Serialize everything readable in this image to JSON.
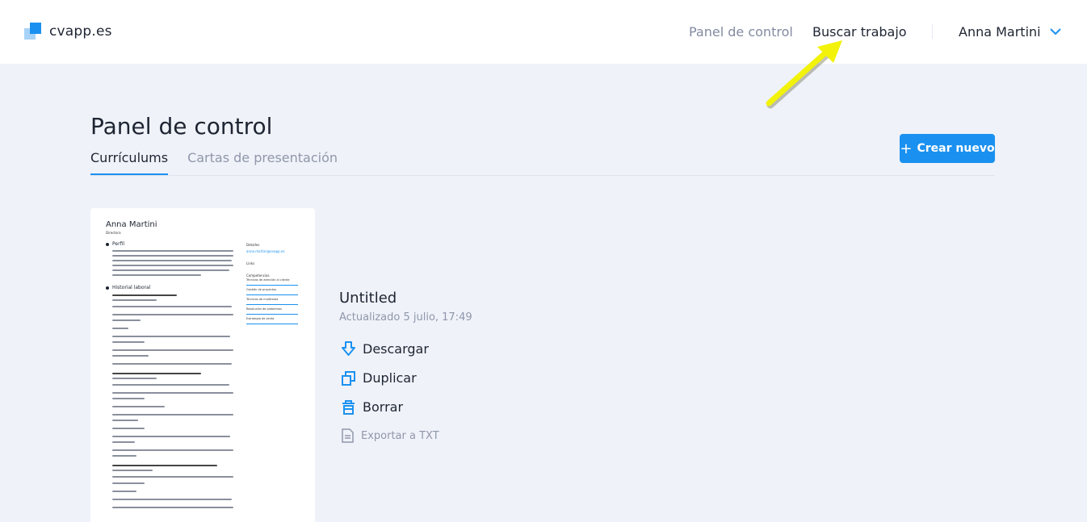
{
  "header": {
    "logo_text": "cvapp.es",
    "nav": {
      "dashboard": "Panel de control",
      "jobs": "Buscar trabajo"
    },
    "user_name": "Anna Martini"
  },
  "main": {
    "title": "Panel de control",
    "tabs": [
      {
        "label": "Currículums",
        "active": true
      },
      {
        "label": "Cartas de presentación",
        "active": false
      }
    ],
    "create_button": "Crear nuevo"
  },
  "resume": {
    "preview": {
      "name": "Anna Martini",
      "role": "Directora",
      "section_profile": "Perfil",
      "section_work": "Historial laboral",
      "side_details": "Detalles",
      "side_email": "anna.martini@cvapp.es",
      "side_links": "Links",
      "side_skills": "Competencias",
      "skills": [
        "Técnicas de atención al cliente",
        "Gestión de proyectos",
        "Técnicas de multitarea",
        "Resolución de problemas",
        "Estrategia de venta"
      ],
      "jobs": [
        "Director general en H&M, Barcelona",
        "Asistente del gerente de tienda, en H&M, Barcelona",
        "Asesora de ventas, en Joyería The Golded Lynx, Barcelona"
      ]
    },
    "title": "Untitled",
    "updated": "Actualizado 5 julio, 17:49",
    "actions": {
      "download": "Descargar",
      "duplicate": "Duplicar",
      "delete": "Borrar",
      "export_txt": "Exportar a TXT"
    }
  },
  "colors": {
    "accent": "#1a91f0",
    "background": "#eff2f9",
    "annotation_arrow": "#f2f20a"
  }
}
